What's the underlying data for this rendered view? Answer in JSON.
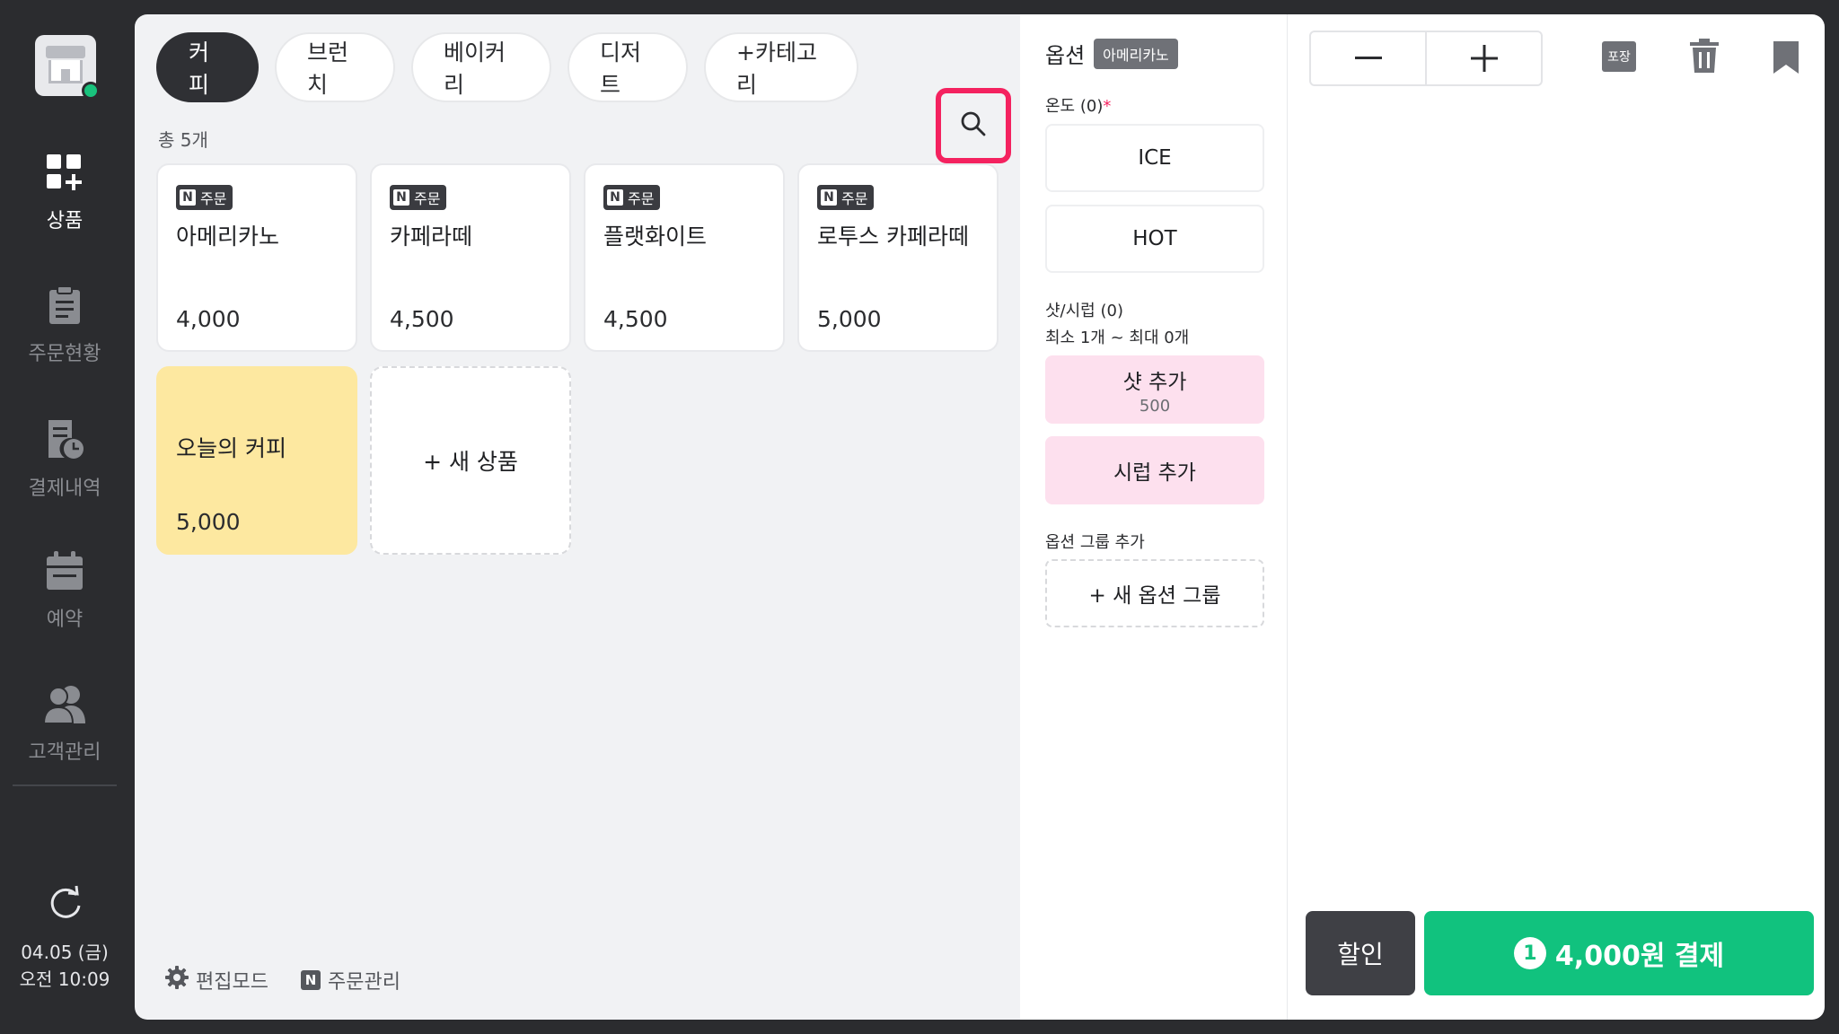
{
  "sidebar": {
    "items": [
      {
        "label": "상품",
        "icon": "products-icon",
        "active": true
      },
      {
        "label": "주문현황",
        "icon": "clipboard-icon",
        "active": false
      },
      {
        "label": "결제내역",
        "icon": "receipt-clock-icon",
        "active": false
      },
      {
        "label": "예약",
        "icon": "calendar-icon",
        "active": false
      },
      {
        "label": "고객관리",
        "icon": "users-icon",
        "active": false
      }
    ],
    "date": "04.05 (금)",
    "time": "오전 10:09"
  },
  "categories": {
    "tabs": [
      "커피",
      "브런치",
      "베이커리",
      "디저트",
      "+카테고리"
    ],
    "active_index": 0
  },
  "product_list": {
    "total_label": "총 5개",
    "badge_text": "주문",
    "badge_n": "N",
    "items": [
      {
        "name": "아메리카노",
        "price": "4,000"
      },
      {
        "name": "카페라떼",
        "price": "4,500"
      },
      {
        "name": "플랫화이트",
        "price": "4,500"
      },
      {
        "name": "로투스 카페라떼",
        "price": "5,000"
      },
      {
        "name": "오늘의 커피",
        "price": "5,000"
      }
    ],
    "new_product_label": "+ 새 상품"
  },
  "footer": {
    "edit_mode_label": "편집모드",
    "order_manage_label": "주문관리"
  },
  "options": {
    "title": "옵션",
    "selected_item": "아메리카노",
    "temperature": {
      "label": "온도 (0)",
      "required_mark": "*",
      "choices": [
        "ICE",
        "HOT"
      ]
    },
    "shot_syrup": {
      "label": "샷/시럽 (0)",
      "range": "최소 1개 ~ 최대 0개",
      "choices": [
        {
          "label": "샷 추가",
          "price": "500"
        },
        {
          "label": "시럽 추가",
          "price": ""
        }
      ]
    },
    "add_group": {
      "label": "옵션 그룹 추가",
      "button": "+ 새 옵션 그룹"
    }
  },
  "cart": {
    "pack_label": "포장",
    "discount_label": "할인",
    "pay_count": "1",
    "pay_label": "4,000원 결제"
  },
  "colors": {
    "accent_green": "#11c27e",
    "highlight_pink": "#f4225f",
    "featured_yellow": "#fde8a0",
    "option_pink": "#fde0ee"
  }
}
